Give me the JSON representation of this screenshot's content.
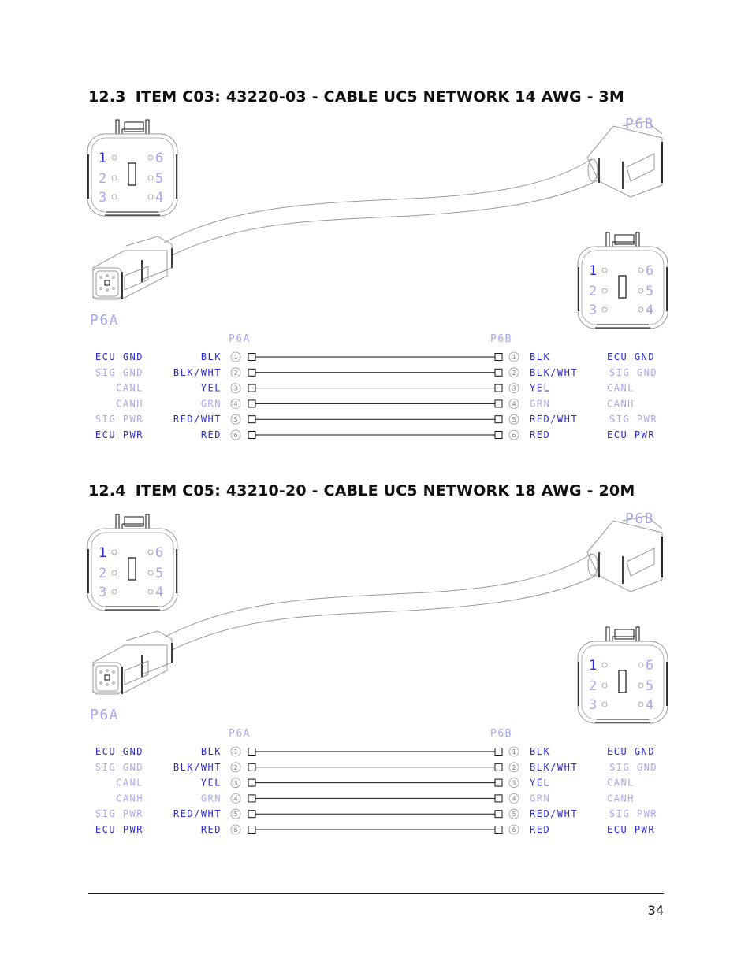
{
  "sections": [
    {
      "number": "12.3",
      "title": "ITEM C03: 43220-03 - CABLE UC5 NETWORK 14 AWG - 3M",
      "connector_a_label": "P6A",
      "connector_b_label": "P6B",
      "face_pins_left": [
        "1",
        "2",
        "3"
      ],
      "face_pins_right": [
        "6",
        "5",
        "4"
      ],
      "wiring": [
        {
          "pin": "1",
          "signal_a": "ECU GND",
          "wire_a": "BLK",
          "wire_b": "BLK",
          "signal_b": "ECU GND"
        },
        {
          "pin": "2",
          "signal_a": "SIG GND",
          "wire_a": "BLK/WHT",
          "wire_b": "BLK/WHT",
          "signal_b": "SIG GND"
        },
        {
          "pin": "3",
          "signal_a": "CANL",
          "wire_a": "YEL",
          "wire_b": "YEL",
          "signal_b": "CANL"
        },
        {
          "pin": "4",
          "signal_a": "CANH",
          "wire_a": "GRN",
          "wire_b": "GRN",
          "signal_b": "CANH"
        },
        {
          "pin": "5",
          "signal_a": "SIG PWR",
          "wire_a": "RED/WHT",
          "wire_b": "RED/WHT",
          "signal_b": "SIG PWR"
        },
        {
          "pin": "6",
          "signal_a": "ECU PWR",
          "wire_a": "RED",
          "wire_b": "RED",
          "signal_b": "ECU PWR"
        }
      ]
    },
    {
      "number": "12.4",
      "title": "ITEM C05: 43210-20 - CABLE UC5 NETWORK 18 AWG - 20M",
      "connector_a_label": "P6A",
      "connector_b_label": "P6B",
      "face_pins_left": [
        "1",
        "2",
        "3"
      ],
      "face_pins_right": [
        "6",
        "5",
        "4"
      ],
      "wiring": [
        {
          "pin": "1",
          "signal_a": "ECU GND",
          "wire_a": "BLK",
          "wire_b": "BLK",
          "signal_b": "ECU GND"
        },
        {
          "pin": "2",
          "signal_a": "SIG GND",
          "wire_a": "BLK/WHT",
          "wire_b": "BLK/WHT",
          "signal_b": "SIG GND"
        },
        {
          "pin": "3",
          "signal_a": "CANL",
          "wire_a": "YEL",
          "wire_b": "YEL",
          "signal_b": "CANL"
        },
        {
          "pin": "4",
          "signal_a": "CANH",
          "wire_a": "GRN",
          "wire_b": "GRN",
          "signal_b": "CANH"
        },
        {
          "pin": "5",
          "signal_a": "SIG PWR",
          "wire_a": "RED/WHT",
          "wire_b": "RED/WHT",
          "signal_b": "SIG PWR"
        },
        {
          "pin": "6",
          "signal_a": "ECU PWR",
          "wire_a": "RED",
          "wire_b": "RED",
          "signal_b": "ECU PWR"
        }
      ]
    }
  ],
  "footer": {
    "page_number": "34"
  },
  "colors": {
    "label_blue": "#2a2ad6",
    "label_light": "#a8a8ee",
    "line": "#111111",
    "outline_gray": "#999999"
  }
}
